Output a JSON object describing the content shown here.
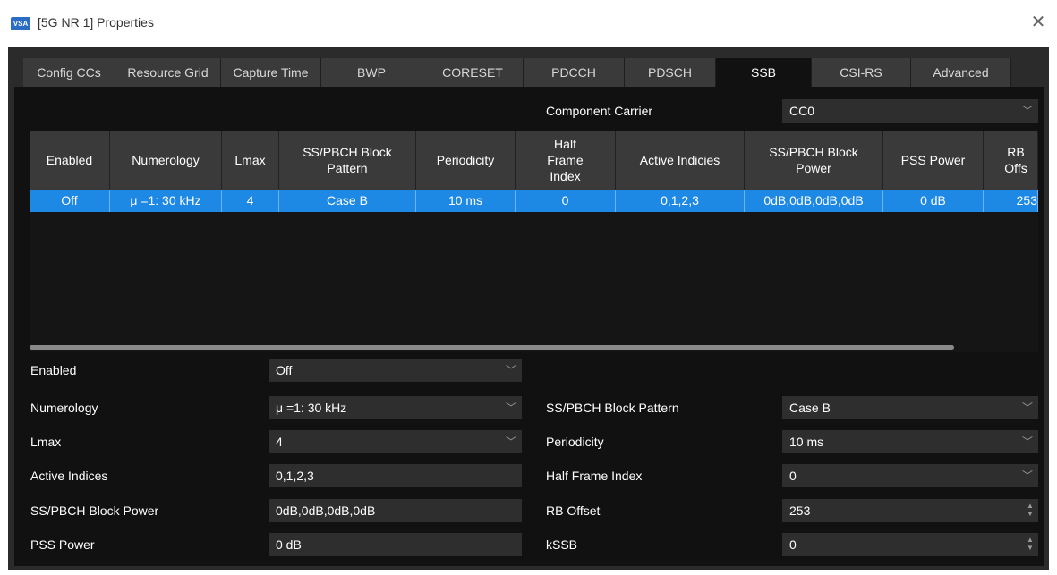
{
  "window": {
    "icon_text": "VSA",
    "title": "[5G NR 1] Properties",
    "close": "✕"
  },
  "tabs": [
    "Config CCs",
    "Resource Grid",
    "Capture Time",
    "BWP",
    "CORESET",
    "PDCCH",
    "PDSCH",
    "SSB",
    "CSI-RS",
    "Advanced"
  ],
  "active_tab": "SSB",
  "component_carrier": {
    "label": "Component Carrier",
    "value": "CC0"
  },
  "table": {
    "headers": [
      "Enabled",
      "Numerology",
      "Lmax",
      "SS/PBCH Block Pattern",
      "Periodicity",
      "Half Frame Index",
      "Active Indicies",
      "SS/PBCH Block Power",
      "PSS Power",
      "RB Offs"
    ],
    "rows": [
      [
        "Off",
        "μ =1: 30 kHz",
        "4",
        "Case B",
        "10 ms",
        "0",
        "0,1,2,3",
        "0dB,0dB,0dB,0dB",
        "0 dB",
        "253"
      ]
    ]
  },
  "form": {
    "enabled": {
      "label": "Enabled",
      "value": "Off"
    },
    "numerology": {
      "label": "Numerology",
      "value": "μ =1: 30 kHz"
    },
    "lmax": {
      "label": "Lmax",
      "value": "4"
    },
    "active_indices": {
      "label": "Active Indices",
      "value": "0,1,2,3"
    },
    "block_power": {
      "label": "SS/PBCH Block Power",
      "value": "0dB,0dB,0dB,0dB"
    },
    "pss_power": {
      "label": "PSS Power",
      "value": "0 dB"
    },
    "block_pattern": {
      "label": "SS/PBCH Block Pattern",
      "value": "Case B"
    },
    "periodicity": {
      "label": "Periodicity",
      "value": "10 ms"
    },
    "half_frame_index": {
      "label": "Half Frame Index",
      "value": "0"
    },
    "rb_offset": {
      "label": "RB Offset",
      "value": "253"
    },
    "kssb": {
      "label": "kSSB",
      "value": "0"
    }
  },
  "colors": {
    "selected_row": "#1e88e5",
    "panel_bg": "#111111",
    "tab_bg": "#3a3a3a"
  }
}
